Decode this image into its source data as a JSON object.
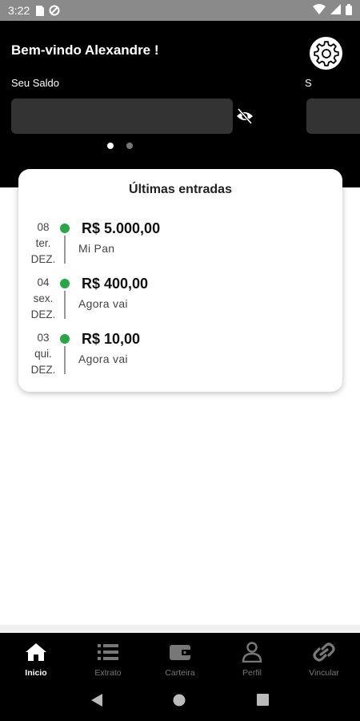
{
  "status_bar": {
    "time": "3:22"
  },
  "header": {
    "welcome": "Bem-vindo Alexandre !",
    "balance_label": "Seu Saldo",
    "balance_label_next": "S"
  },
  "card": {
    "title": "Últimas entradas",
    "entries": [
      {
        "day": "08",
        "weekday": "ter.",
        "month": "DEZ.",
        "amount": "R$ 5.000,00",
        "description": "Mi Pan"
      },
      {
        "day": "04",
        "weekday": "sex.",
        "month": "DEZ.",
        "amount": "R$ 400,00",
        "description": "Agora vai"
      },
      {
        "day": "03",
        "weekday": "qui.",
        "month": "DEZ.",
        "amount": "R$ 10,00",
        "description": "Agora vai"
      }
    ]
  },
  "bottom_nav": {
    "items": [
      {
        "label": "Inicio",
        "icon": "home-icon",
        "active": true
      },
      {
        "label": "Extrato",
        "icon": "list-icon",
        "active": false
      },
      {
        "label": "Carteira",
        "icon": "wallet-icon",
        "active": false
      },
      {
        "label": "Perfil",
        "icon": "person-icon",
        "active": false
      },
      {
        "label": "Vincular",
        "icon": "link-icon",
        "active": false
      }
    ]
  },
  "colors": {
    "header_bg": "#000000",
    "accent_green": "#28a745",
    "balance_box": "#333333"
  }
}
